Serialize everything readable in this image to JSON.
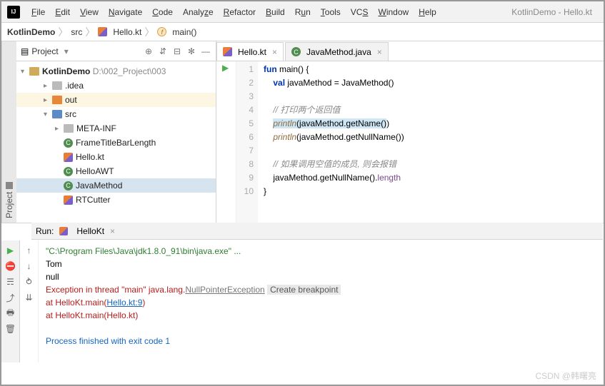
{
  "window": {
    "title": "KotlinDemo - Hello.kt"
  },
  "menu": [
    "File",
    "Edit",
    "View",
    "Navigate",
    "Code",
    "Analyze",
    "Refactor",
    "Build",
    "Run",
    "Tools",
    "VCS",
    "Window",
    "Help"
  ],
  "breadcrumb": {
    "project": "KotlinDemo",
    "folder": "src",
    "file": "Hello.kt",
    "func": "main()"
  },
  "project_panel": {
    "title": "Project",
    "root": "KotlinDemo",
    "root_path": "D:\\002_Project\\003",
    "items": [
      {
        "name": ".idea",
        "indent": 2,
        "icon": "folder-grey",
        "arrow": ">"
      },
      {
        "name": "out",
        "indent": 2,
        "icon": "folder-orange",
        "arrow": ">",
        "cls": "out"
      },
      {
        "name": "src",
        "indent": 2,
        "icon": "folder-blue",
        "arrow": "v"
      },
      {
        "name": "META-INF",
        "indent": 3,
        "icon": "folder-grey",
        "arrow": ">"
      },
      {
        "name": "FrameTitleBarLength",
        "indent": 3,
        "icon": "c"
      },
      {
        "name": "Hello.kt",
        "indent": 3,
        "icon": "kt"
      },
      {
        "name": "HelloAWT",
        "indent": 3,
        "icon": "c"
      },
      {
        "name": "JavaMethod",
        "indent": 3,
        "icon": "c",
        "cls": "sel"
      },
      {
        "name": "RTCutter",
        "indent": 3,
        "icon": "kt"
      }
    ]
  },
  "tabs": [
    {
      "label": "Hello.kt",
      "icon": "kt",
      "active": true
    },
    {
      "label": "JavaMethod.java",
      "icon": "c",
      "active": false
    }
  ],
  "code": {
    "lines": [
      1,
      2,
      3,
      4,
      5,
      6,
      7,
      8,
      9,
      10
    ],
    "l1a": "fun",
    "l1b": " main() {",
    "l2a": "val",
    "l2b": " javaMethod = JavaMethod()",
    "l4": "// 打印两个返回值",
    "l5a": "println",
    "l5b": "(javaMethod.getName()",
    "l5c": ")",
    "l6a": "println",
    "l6b": "(javaMethod.getNullName())",
    "l8": "// 如果调用空值的成员, 则会报错",
    "l9a": "javaMethod.getNullName().",
    "l9b": "length",
    "l10": "}"
  },
  "run": {
    "label": "Run:",
    "config": "HelloKt",
    "lines": {
      "cmd": "\"C:\\Program Files\\Java\\jdk1.8.0_91\\bin\\java.exe\" ...",
      "out1": "Tom",
      "out2": "null",
      "ex_pre": "Exception in thread \"main\" java.lang.",
      "ex_cls": "NullPointerException",
      "ex_btn": "Create breakpoint",
      "trace1_pre": "    at HelloKt.main(",
      "trace1_link": "Hello.kt:9",
      "trace1_post": ")",
      "trace2": "    at HelloKt.main(Hello.kt)",
      "exit": "Process finished with exit code 1"
    }
  },
  "watermark": "CSDN @韩曙亮"
}
